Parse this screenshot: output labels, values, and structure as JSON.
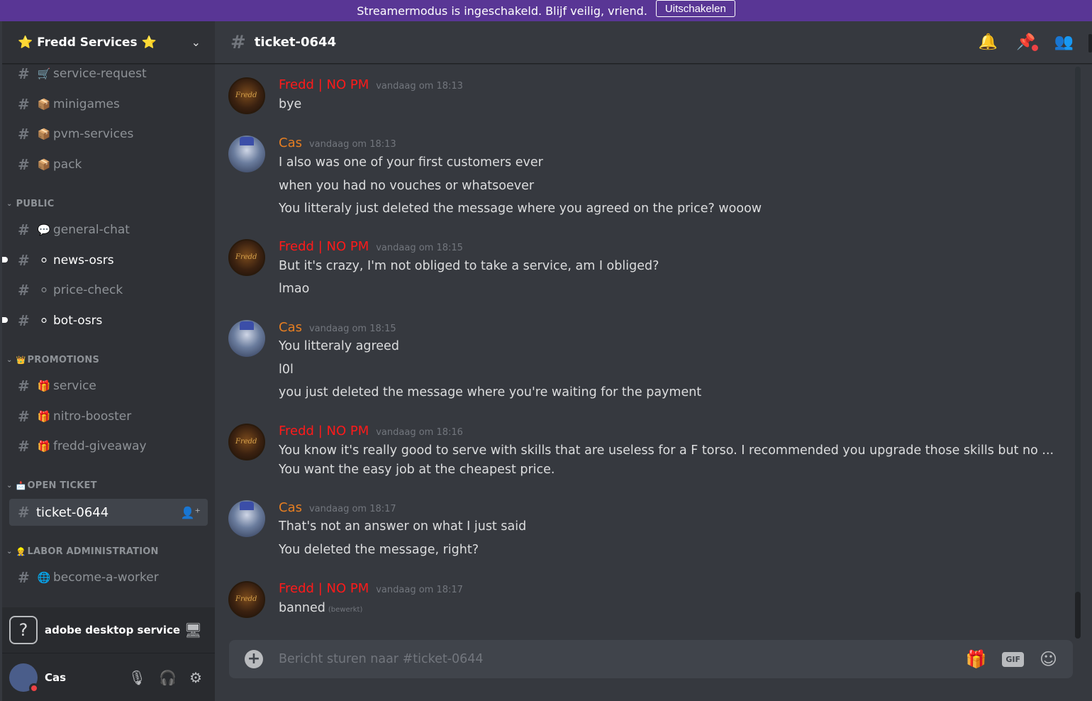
{
  "banner": {
    "text": "Streamermodus is ingeschakeld. Blijf veilig, vriend.",
    "button_label": "Uitschakelen"
  },
  "server": {
    "name": "⭐ Fredd Services ⭐"
  },
  "channels": {
    "top": [
      {
        "emoji": "🛒",
        "label": "service-request"
      },
      {
        "emoji": "📦",
        "label": "minigames"
      },
      {
        "emoji": "📦",
        "label": "pvm-services"
      },
      {
        "emoji": "📦",
        "label": "pack"
      }
    ],
    "public": {
      "name": "PUBLIC",
      "items": [
        {
          "emoji": "💬",
          "label": "general-chat"
        },
        {
          "emoji": "⚪",
          "label": "news-osrs"
        },
        {
          "emoji": "⚪",
          "label": "price-check"
        },
        {
          "emoji": "⚪",
          "label": "bot-osrs"
        }
      ]
    },
    "promotions": {
      "name": "PROMOTIONS",
      "emoji": "👑",
      "items": [
        {
          "emoji": "🎁",
          "label": "service"
        },
        {
          "emoji": "🎁",
          "label": "nitro-booster"
        },
        {
          "emoji": "🎁",
          "label": "fredd-giveaway"
        }
      ]
    },
    "open_ticket": {
      "name": "OPEN TICKET",
      "emoji": "📩",
      "items": [
        {
          "label": "ticket-0644"
        }
      ]
    },
    "labor": {
      "name": "LABOR ADMINISTRATION",
      "emoji": "👷",
      "items": [
        {
          "emoji": "🌐",
          "label": "become-a-worker"
        }
      ]
    }
  },
  "voice": {
    "icon": "question-mark",
    "label": "adobe desktop service"
  },
  "user": {
    "name": "Cas"
  },
  "channel_header": {
    "title": "ticket-0644"
  },
  "messages": [
    {
      "author": "Fredd | NO PM",
      "color": "#ff1a1a",
      "time": "vandaag om 18:13",
      "lines": [
        "bye"
      ]
    },
    {
      "author": "Cas",
      "color": "#e67e22",
      "time": "vandaag om 18:13",
      "lines": [
        "I also was one of your first customers ever",
        "when you had no vouches or whatsoever",
        "You litteraly just deleted the message where you agreed on the price? wooow"
      ]
    },
    {
      "author": "Fredd | NO PM",
      "color": "#ff1a1a",
      "time": "vandaag om 18:15",
      "lines": [
        "But it's crazy, I'm not obliged to take a service, am I obliged?",
        "lmao"
      ]
    },
    {
      "author": "Cas",
      "color": "#e67e22",
      "time": "vandaag om 18:15",
      "lines": [
        "You litteraly agreed",
        "l0l",
        "you just deleted the message where you're waiting for the payment"
      ]
    },
    {
      "author": "Fredd | NO PM",
      "color": "#ff1a1a",
      "time": "vandaag om 18:16",
      "lines": [
        "You know it's really good to serve with skills that are useless for a F torso. I recommended you upgrade those skills but no ...",
        "You want the easy job at the cheapest price."
      ]
    },
    {
      "author": "Cas",
      "color": "#e67e22",
      "time": "vandaag om 18:17",
      "lines": [
        "That's not an answer on what I just said",
        "You deleted the message, right?"
      ]
    },
    {
      "author": "Fredd | NO PM",
      "color": "#ff1a1a",
      "time": "vandaag om 18:17",
      "lines": [
        "banned"
      ],
      "edited": "(bewerkt)"
    }
  ],
  "composer": {
    "placeholder": "Bericht sturen naar #ticket-0644",
    "gif_label": "GIF"
  }
}
